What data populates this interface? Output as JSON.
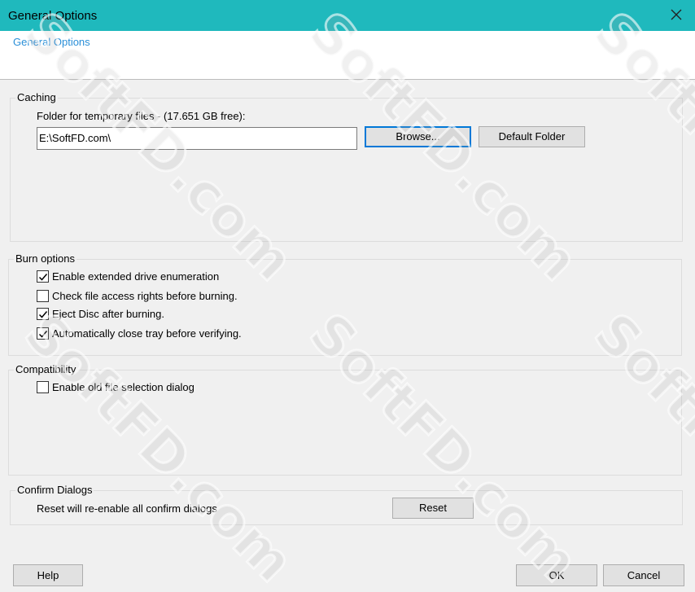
{
  "window": {
    "title": "General Options",
    "close_icon": "close-icon"
  },
  "header": {
    "link": "General Options"
  },
  "caching": {
    "group_title": "Caching",
    "folder_label": "Folder for temporary files - (17.651  GB free):",
    "folder_value": "E:\\SoftFD.com\\",
    "browse_label": "Browse...",
    "default_folder_label": "Default Folder"
  },
  "burn_options": {
    "group_title": "Burn options",
    "items": [
      {
        "label": "Enable extended drive enumeration",
        "checked": true
      },
      {
        "label": "Check file access rights before burning.",
        "checked": false
      },
      {
        "label": "Eject Disc after burning.",
        "checked": true
      },
      {
        "label": "Automatically close tray before verifying.",
        "checked": true
      }
    ]
  },
  "compatibility": {
    "group_title": "Compatibility",
    "items": [
      {
        "label": "Enable old file selection dialog",
        "checked": false
      }
    ]
  },
  "confirm_dialogs": {
    "group_title": "Confirm Dialogs",
    "description": "Reset will re-enable all confirm dialogs",
    "reset_label": "Reset"
  },
  "footer": {
    "help_label": "Help",
    "ok_label": "OK",
    "cancel_label": "Cancel"
  },
  "watermark": {
    "text": "SoftFD.com"
  },
  "colors": {
    "titlebar": "#1fb9bd",
    "link": "#2a8fd8",
    "focus_border": "#0078d7"
  }
}
